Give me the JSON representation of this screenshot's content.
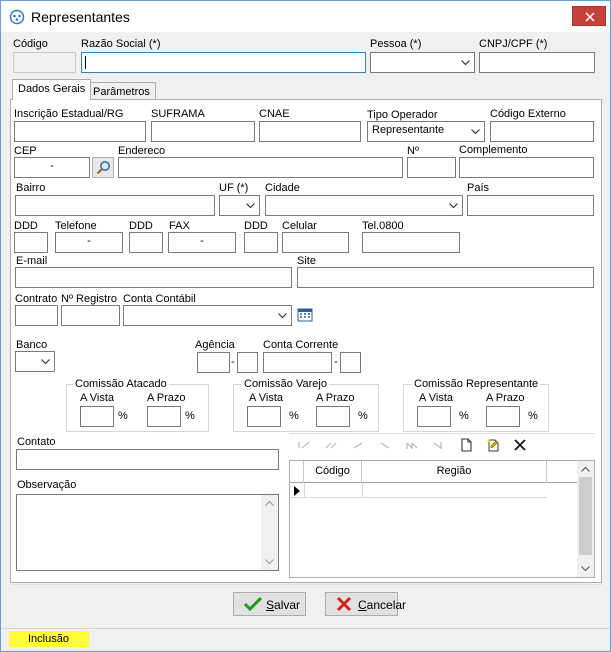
{
  "window": {
    "title": "Representantes",
    "close_icon": "close-icon",
    "title_icon": "app-icon"
  },
  "header": {
    "codigo_label": "Código",
    "razao_label": "Razão Social (*)",
    "pessoa_label": "Pessoa (*)",
    "cnpj_label": "CNPJ/CPF (*)"
  },
  "tabs": [
    {
      "label": "Dados Gerais"
    },
    {
      "label": "Parâmetros"
    }
  ],
  "fields": {
    "inscricao_label": "Inscrição Estadual/RG",
    "suframa_label": "SUFRAMA",
    "cnae_label": "CNAE",
    "tipo_operador_label": "Tipo Operador",
    "tipo_operador_value": "Representante",
    "codigo_externo_label": "Código Externo",
    "cep_label": "CEP",
    "cep_value": "-",
    "endereco_label": "Endereco",
    "numero_label": "Nº",
    "complemento_label": "Complemento",
    "bairro_label": "Bairro",
    "uf_label": "UF (*)",
    "cidade_label": "Cidade",
    "pais_label": "País",
    "ddd1_label": "DDD",
    "telefone_label": "Telefone",
    "telefone_value": "-",
    "ddd2_label": "DDD",
    "fax_label": "FAX",
    "fax_value": "-",
    "ddd3_label": "DDD",
    "celular_label": "Celular",
    "tel0800_label": "Tel.0800",
    "email_label": "E-mail",
    "site_label": "Site",
    "contrato_label": "Contrato",
    "registro_label": "Nº Registro",
    "conta_contabil_label": "Conta Contábil",
    "banco_label": "Banco",
    "agencia_label": "Agência",
    "agencia_sep": "-",
    "conta_corrente_label": "Conta Corrente",
    "conta_sep": "-"
  },
  "comissoes": [
    {
      "title": "Comissão Atacado",
      "vista": "A Vista",
      "prazo": "A Prazo",
      "pct": "%"
    },
    {
      "title": "Comissão Varejo",
      "vista": "A Vista",
      "prazo": "A Prazo",
      "pct": "%"
    },
    {
      "title": "Comissão Representante",
      "vista": "A Vista",
      "prazo": "A Prazo",
      "pct": "%"
    }
  ],
  "contato_label": "Contato",
  "observacao_label": "Observação",
  "grid": {
    "columns": [
      "Código",
      "Região"
    ]
  },
  "buttons": {
    "salvar_prefix": "S",
    "salvar_rest": "alvar",
    "cancelar_prefix": "C",
    "cancelar_rest": "ancelar"
  },
  "status": {
    "mode": "Inclusão",
    "mode_color": "#ffff38"
  },
  "colors": {
    "close_button": "#c7423b",
    "focus_border": "#3c7fb1"
  }
}
